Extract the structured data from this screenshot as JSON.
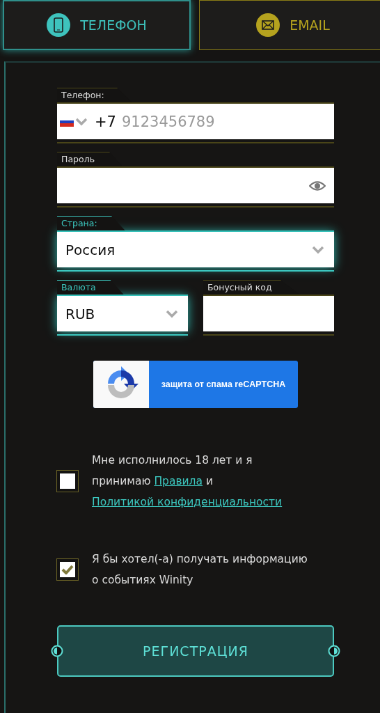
{
  "tabs": [
    {
      "kind": "phone",
      "label": "ТЕЛЕФОН",
      "selected": true
    },
    {
      "kind": "email",
      "label": "EMAIL",
      "selected": false
    }
  ],
  "form_rows": [
    [
      {
        "kind": "phone",
        "label": "Телефон:",
        "dial_code": "+7",
        "placeholder": "9123456789",
        "focused": false
      }
    ],
    [
      {
        "kind": "password",
        "label": "Пароль",
        "focused": false
      }
    ],
    [
      {
        "kind": "select",
        "label": "Страна:",
        "value": "Россия",
        "focused": true
      }
    ],
    [
      {
        "kind": "select",
        "label": "Валюта",
        "value": "RUB",
        "focused": true
      },
      {
        "kind": "text",
        "label": "Бонусный код",
        "focused": false
      }
    ]
  ],
  "captcha": {
    "label": "защита от спама reCAPTCHA"
  },
  "checkboxes": [
    {
      "checked": false,
      "parts": [
        {
          "text": "Мне исполнилось 18 лет и я принимаю "
        },
        {
          "text": "Правила",
          "link": true
        },
        {
          "text": " и "
        },
        {
          "text": "Политикой конфиденциальности",
          "link": true
        }
      ]
    },
    {
      "checked": true,
      "parts": [
        {
          "text": "Я бы хотел(-а) получать информацию о событиях Winity"
        }
      ]
    }
  ],
  "submit": {
    "label": "РЕГИСТРАЦИЯ"
  }
}
